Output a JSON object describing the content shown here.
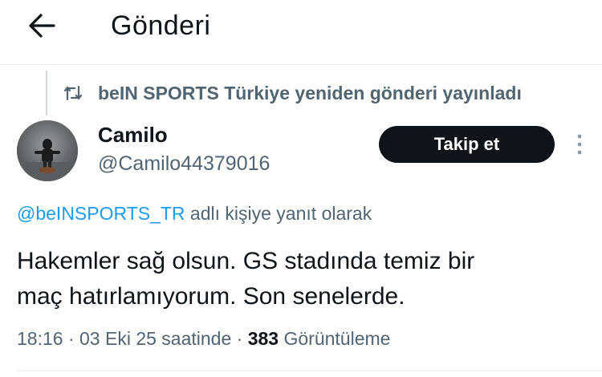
{
  "header": {
    "back_icon": "arrow-left-icon",
    "title": "Gönderi"
  },
  "repost": {
    "icon": "repost-icon",
    "text": "beIN SPORTS Türkiye yeniden gönderi yayınladı"
  },
  "post": {
    "author": {
      "display_name": "Camilo",
      "handle": "@Camilo44379016"
    },
    "follow_label": "Takip et",
    "more_icon": "more-vertical-icon",
    "reply_to": {
      "mention": "@beINSPORTS_TR",
      "suffix": " adlı kişiye yanıt olarak"
    },
    "text_line1": "Hakemler sağ olsun. GS stadında temiz bir",
    "text_line2": "maç hatırlamıyorum. Son senelerde.",
    "time": "18:16",
    "separator": " · ",
    "date": "03 Eki 25 saatinde",
    "views_count": "383",
    "views_label": " Görüntüleme"
  },
  "colors": {
    "text_primary": "#0f1419",
    "text_secondary": "#536471",
    "link": "#1d9bf0",
    "button_bg": "#0f1419",
    "divider": "#e8eaec"
  }
}
